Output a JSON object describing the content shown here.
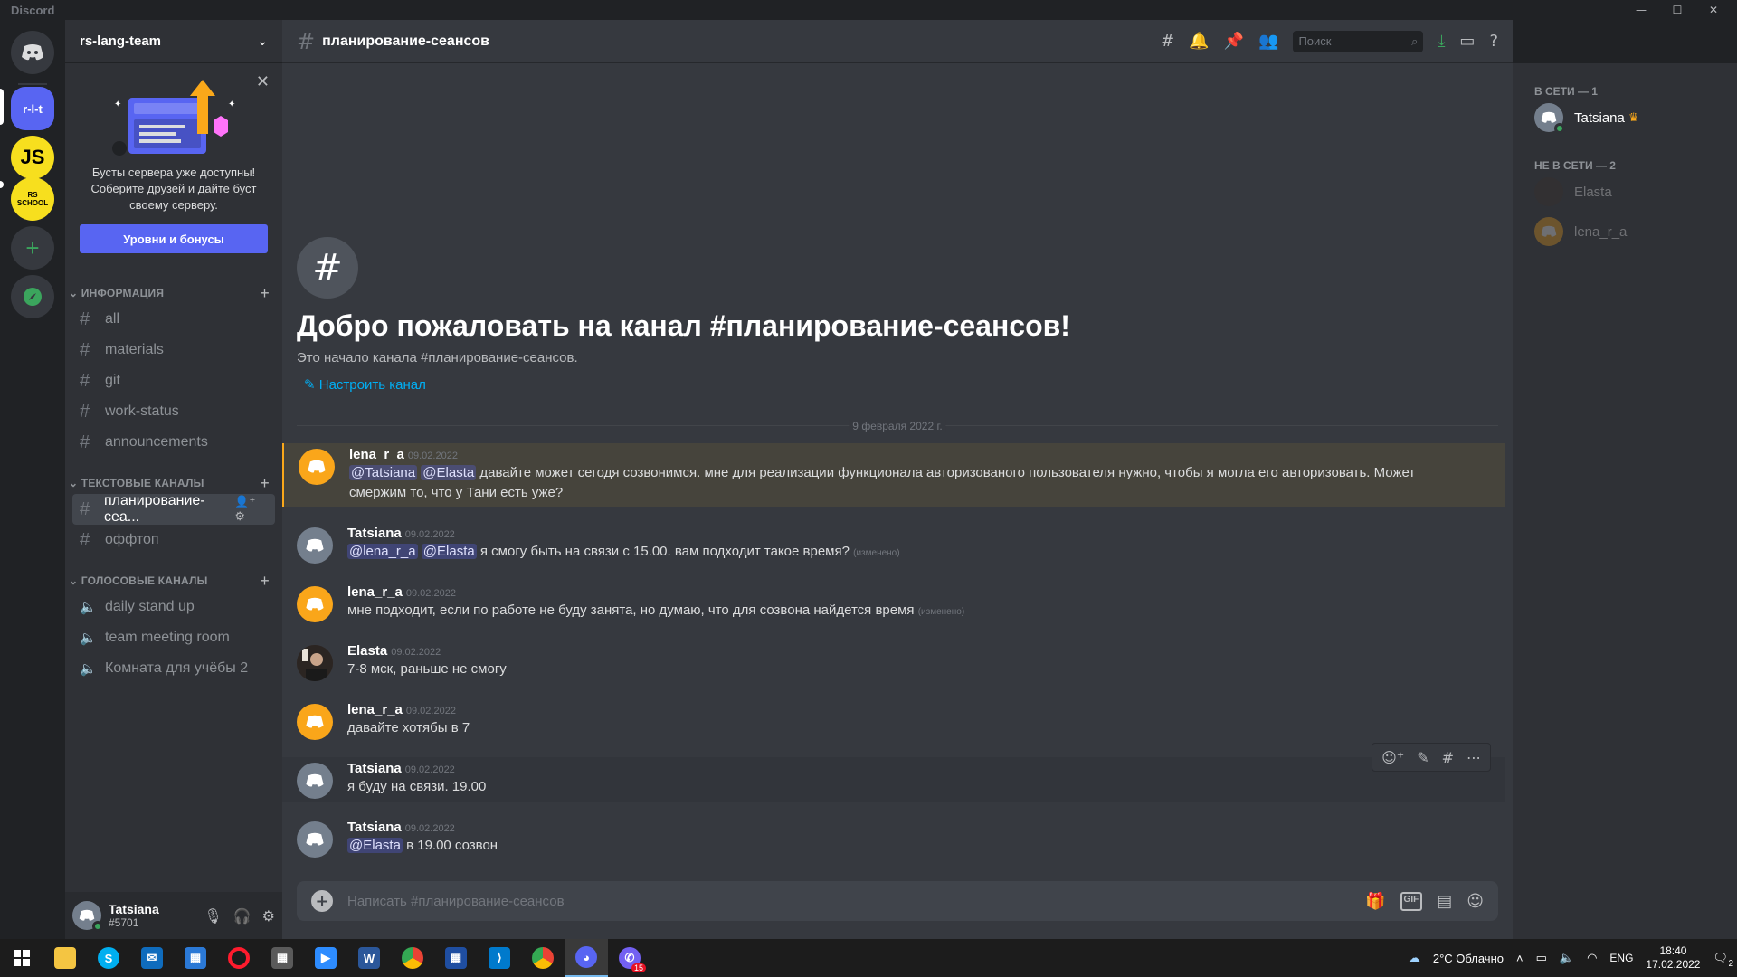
{
  "window": {
    "app_name": "Discord"
  },
  "servers": [
    {
      "label": "r-l-t",
      "bg": "#5865f2"
    },
    {
      "label": "JS",
      "bg": "#f7df1e"
    },
    {
      "label": "RS SCHOOL",
      "bg": "#f7df1e"
    }
  ],
  "guild": {
    "name": "rs-lang-team"
  },
  "boost": {
    "text": "Бусты сервера уже доступны! Соберите друзей и дайте буст своему серверу.",
    "button": "Уровни и бонусы"
  },
  "categories": {
    "info": "ИНФОРМАЦИЯ",
    "text": "ТЕКСТОВЫЕ КАНАЛЫ",
    "voice": "ГОЛОСОВЫЕ КАНАЛЫ"
  },
  "info_channels": [
    "all",
    "materials",
    "git",
    "work-status",
    "announcements"
  ],
  "text_channels": [
    "планирование-сеа...",
    "оффтоп"
  ],
  "voice_channels": [
    "daily stand up",
    "team meeting room",
    "Комната для учёбы 2"
  ],
  "user": {
    "name": "Tatsiana",
    "tag": "#5701"
  },
  "channel": {
    "name": "планирование-сеансов",
    "search_placeholder": "Поиск",
    "welcome_title": "Добро пожаловать на канал #планирование-сеансов!",
    "welcome_sub": "Это начало канала #планирование-сеансов.",
    "edit_link": "Настроить канал",
    "date_divider": "9 февраля 2022 г.",
    "composer_placeholder": "Написать #планирование-сеансов"
  },
  "messages": [
    {
      "author": "lena_r_a",
      "ts": "09.02.2022",
      "m1": "@Tatsiana",
      "m2": "@Elasta",
      "text": "давайте может сегодя созвонимся. мне для реализации функционала авторизованого пользователя нужно, чтобы я могла его авторизовать. Может смержим то, что у Тани есть уже?"
    },
    {
      "author": "Tatsiana",
      "ts": "09.02.2022",
      "m1": "@lena_r_a",
      "m2": "@Elasta",
      "text": "я смогу быть на связи с 15.00. вам подходит такое время?",
      "edited": "(изменено)"
    },
    {
      "author": "lena_r_a",
      "ts": "09.02.2022",
      "text": "мне подходит, если по работе не буду занята, но думаю, что для созвона найдется время",
      "edited": "(изменено)"
    },
    {
      "author": "Elasta",
      "ts": "09.02.2022",
      "text": "7-8 мск, раньше не смогу"
    },
    {
      "author": "lena_r_a",
      "ts": "09.02.2022",
      "text": "давайте хотябы в 7"
    },
    {
      "author": "Tatsiana",
      "ts": "09.02.2022",
      "text": "я буду на связи. 19.00"
    },
    {
      "author": "Tatsiana",
      "ts": "09.02.2022",
      "m1": "@Elasta",
      "text": "в 19.00 созвон"
    }
  ],
  "members": {
    "online_header": "В СЕТИ — 1",
    "offline_header": "НЕ В СЕТИ — 2",
    "online": [
      "Tatsiana"
    ],
    "offline": [
      "Elasta",
      "lena_r_a"
    ]
  },
  "taskbar": {
    "weather": "2°C  Облачно",
    "lang": "ENG",
    "time": "18:40",
    "date": "17.02.2022",
    "notif_count": "2",
    "viber_badge": "15"
  },
  "colors": {
    "accent": "#5865f2",
    "orange_avatar": "#faa61a",
    "gray_avatar": "#747f8d",
    "mention_bg": "#5865f2"
  }
}
